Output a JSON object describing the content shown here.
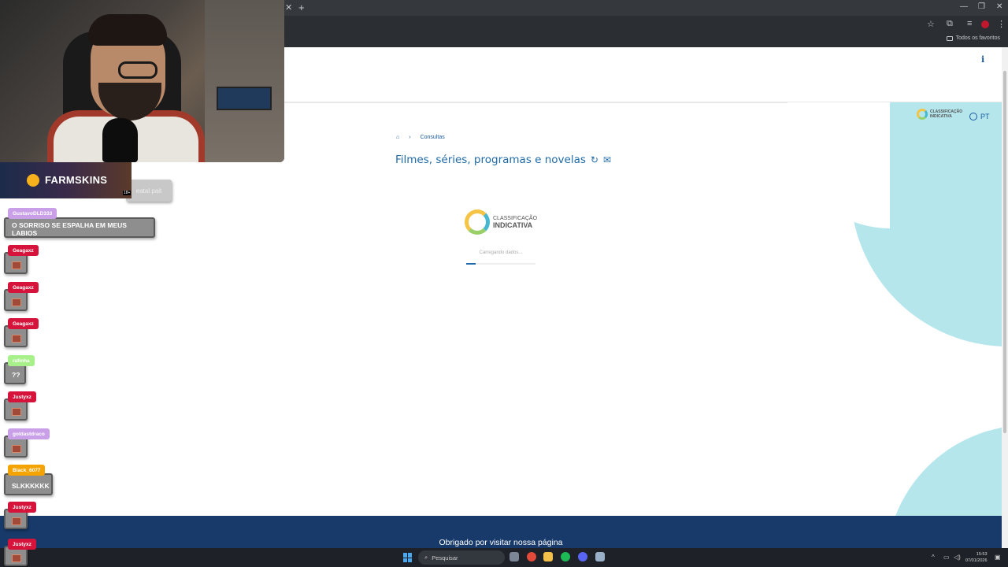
{
  "browser": {
    "bookmark_folder": "Todos os favoritos"
  },
  "page": {
    "lang": "PT",
    "breadcrumb_item": "Consultas",
    "title": "Filmes, séries, programas e novelas",
    "logo_line1": "CLASSIFICAÇÃO",
    "logo_line2": "INDICATIVA",
    "loading_text": "Carregando dados...",
    "loading_progress": 0.14,
    "footer_text": "Obrigado por visitar nossa página"
  },
  "colors": {
    "accent": "#1f6aa8",
    "footer": "#183a6a",
    "blob": "#b4e6ec"
  },
  "taskbar": {
    "search_label": "Pesquisar",
    "time": "15:53",
    "date": "07/01/2026"
  },
  "overlay": {
    "banner_text": "FARMSKINS",
    "banner_age": "18+",
    "partial_msg": "eatal pait",
    "chat": [
      {
        "user": "GustavoDLD333",
        "color": "#c9a0e8",
        "message": "O SORRISO SE ESPALHA EM MEUS LABIOS",
        "type": "text"
      },
      {
        "user": "Geagaxz",
        "color": "#d6133a",
        "message": "",
        "type": "emote"
      },
      {
        "user": "Geagaxz",
        "color": "#d6133a",
        "message": "",
        "type": "emote"
      },
      {
        "user": "Geagaxz",
        "color": "#d6133a",
        "message": "",
        "type": "emote"
      },
      {
        "user": "rafinha",
        "color": "#a8f08a",
        "message": "??",
        "type": "text"
      },
      {
        "user": "Justyxz",
        "color": "#d6133a",
        "message": "",
        "type": "emote"
      },
      {
        "user": "goldastdraco",
        "color": "#c9a0e8",
        "message": "",
        "type": "emote"
      },
      {
        "user": "Black_6077",
        "color": "#f5a300",
        "message": "SLKKKKKK",
        "type": "text"
      },
      {
        "user": "Justyxz",
        "color": "#d6133a",
        "message": "",
        "type": "emote"
      },
      {
        "user": "Justyxz",
        "color": "#d6133a",
        "message": "",
        "type": "emote"
      }
    ]
  }
}
